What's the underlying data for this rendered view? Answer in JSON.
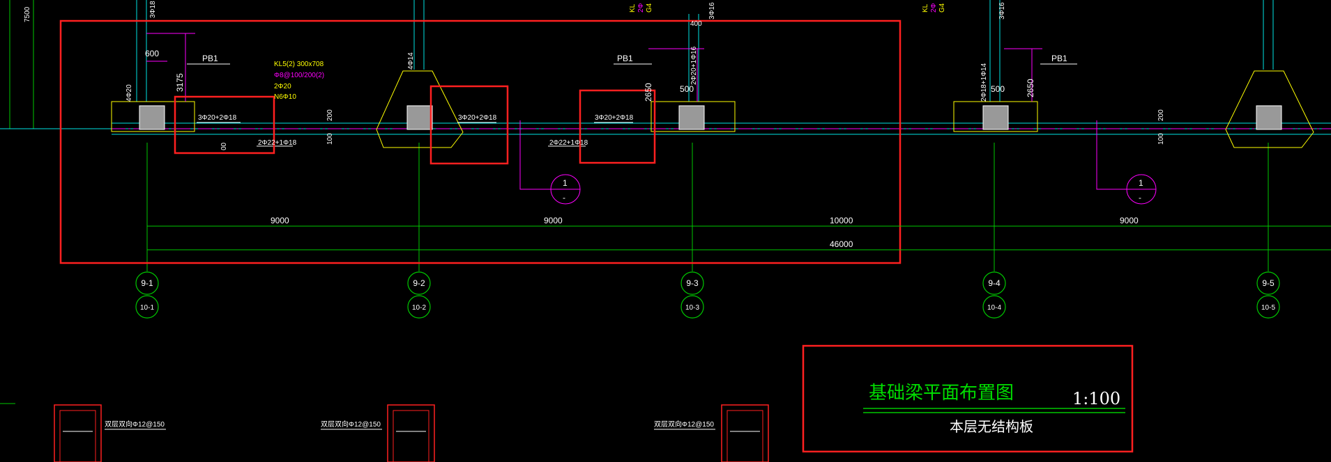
{
  "colors": {
    "background": "#000000",
    "axis": "#00c800",
    "beam": "#ffff00",
    "highlight": "#ff2020",
    "column": "#00e5e5",
    "magenta": "#ff00ff",
    "white": "#ffffff"
  },
  "labels": {
    "left_elev": "7500",
    "pb1_a": "PB1",
    "pb1_b": "PB1",
    "pb1_c": "PB1",
    "dim_600": "600",
    "dim_3175": "3175",
    "dim_2650_a": "2650",
    "dim_2650_b": "2650",
    "dim_500_a": "500",
    "dim_500_b": "500",
    "dim_400": "400",
    "dim_200_a": "200",
    "dim_100_a": "100",
    "dim_200_b": "200",
    "dim_100_b": "100",
    "dim_00": "00",
    "col_4phi20": "4Φ20",
    "col_3phi18": "3Φ18",
    "col_4phi14": "4Φ14",
    "col_2phi20_1phi16": "2Φ20+1Φ16",
    "col_3phi16_a": "3Φ16",
    "col_3phi16_b": "3Φ16",
    "col_2phi18_1phi14": "2Φ18+1Φ14",
    "kl5_name": "KL5(2) 300x708",
    "kl5_stirrup": "Φ8@100/200(2)",
    "kl5_top": "2Φ20",
    "kl5_side": "N6Φ10",
    "rebar_top_1": "3Φ20+2Φ18",
    "rebar_bot_1": "2Φ22+1Φ18",
    "rebar_top_2": "3Φ20+2Φ18",
    "rebar_top_3": "3Φ20+2Φ18",
    "rebar_bot_2": "2Φ22+1Φ18",
    "top_kl_a": "KL",
    "top_kl_b": "KL",
    "top_g4_a": "G4",
    "top_g4_b": "G4",
    "top_2phi_a": "2Φ",
    "top_2phi_b": "2Φ",
    "section_num_1": "1",
    "section_num_2": "1",
    "section_dash": "-",
    "span_1": "9000",
    "span_2": "9000",
    "span_3": "10000",
    "span_4": "9000",
    "total": "46000",
    "axis_9_1": "9-1",
    "axis_10_1": "10-1",
    "axis_9_2": "9-2",
    "axis_10_2": "10-2",
    "axis_9_3": "9-3",
    "axis_10_3": "10-3",
    "axis_9_4": "9-4",
    "axis_10_4": "10-4",
    "axis_9_5": "9-5",
    "axis_10_5": "10-5",
    "bot_note_1": "双层双向Φ12@150",
    "bot_note_2": "双层双向Φ12@150",
    "bot_note_3": "双层双向Φ12@150",
    "title": "基础梁平面布置图",
    "scale": "1:100",
    "subtitle": "本层无结构板"
  }
}
